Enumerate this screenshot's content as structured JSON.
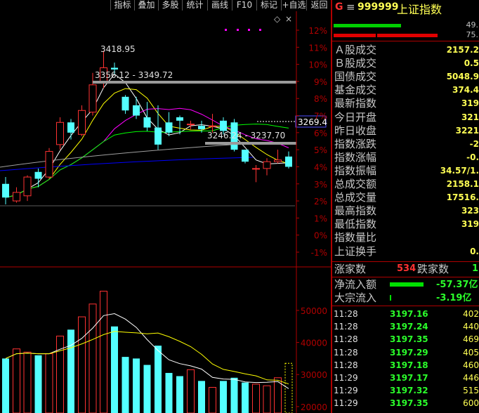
{
  "toolbar": {
    "buttons": [
      "指标",
      "叠加",
      "多股",
      "统计",
      "画线",
      "F10",
      "标记",
      "+自选",
      "返回"
    ]
  },
  "header": {
    "g_label": "G",
    "menu_glyph": "≡",
    "code": "999999",
    "name": "上证指数",
    "bar_value_1": "49.",
    "bar_value_2": "75."
  },
  "chart": {
    "price_annotations": {
      "high": "3418.95",
      "range1": "3356.12 - 3349.72",
      "range2": "3246.24 - 3237.70",
      "current": "3269.4"
    },
    "pct_axis": [
      "12%",
      "11%",
      "10%",
      "9%",
      "8%",
      "7%",
      "6%",
      "5%",
      "4%",
      "3%",
      "2%",
      "1%",
      "0%",
      "-1%"
    ],
    "vol_axis": [
      "50000",
      "40000",
      "30000",
      "20000"
    ]
  },
  "chart_data": {
    "type": "candlestick",
    "candles": [
      {
        "o": 3.0,
        "c": 2.2,
        "h": 3.4,
        "l": 1.8
      },
      {
        "o": 2.0,
        "c": 2.5,
        "h": 2.8,
        "l": 1.9
      },
      {
        "o": 2.3,
        "c": 3.4,
        "h": 3.5,
        "l": 2.0
      },
      {
        "o": 3.7,
        "c": 3.3,
        "h": 3.9,
        "l": 2.8
      },
      {
        "o": 3.4,
        "c": 4.9,
        "h": 5.1,
        "l": 3.3
      },
      {
        "o": 5.3,
        "c": 6.6,
        "h": 6.9,
        "l": 5.0
      },
      {
        "o": 6.6,
        "c": 6.0,
        "h": 6.8,
        "l": 5.6
      },
      {
        "o": 5.9,
        "c": 7.3,
        "h": 7.6,
        "l": 5.8
      },
      {
        "o": 7.2,
        "c": 8.8,
        "h": 9.5,
        "l": 7.0
      },
      {
        "o": 9.0,
        "c": 9.8,
        "h": 10.8,
        "l": 8.6
      },
      {
        "o": 9.8,
        "c": 9.7,
        "h": 10.1,
        "l": 9.4
      },
      {
        "o": 8.1,
        "c": 7.3,
        "h": 8.2,
        "l": 7.1
      },
      {
        "o": 7.6,
        "c": 7.0,
        "h": 8.1,
        "l": 6.8
      },
      {
        "o": 6.9,
        "c": 6.3,
        "h": 7.8,
        "l": 6.1
      },
      {
        "o": 6.3,
        "c": 5.3,
        "h": 7.6,
        "l": 5.0
      },
      {
        "o": 6.6,
        "c": 6.0,
        "h": 7.2,
        "l": 5.8
      },
      {
        "o": 6.9,
        "c": 6.7,
        "h": 7.0,
        "l": 5.9
      },
      {
        "o": 6.5,
        "c": 6.5,
        "h": 6.7,
        "l": 6.2
      },
      {
        "o": 6.4,
        "c": 6.2,
        "h": 6.7,
        "l": 6.0
      },
      {
        "o": 6.4,
        "c": 6.4,
        "h": 7.1,
        "l": 6.0
      },
      {
        "o": 6.7,
        "c": 6.1,
        "h": 6.9,
        "l": 5.9
      },
      {
        "o": 6.6,
        "c": 5.0,
        "h": 6.8,
        "l": 4.9
      },
      {
        "o": 5.0,
        "c": 4.3,
        "h": 5.0,
        "l": 4.2
      },
      {
        "o": 3.9,
        "c": 3.9,
        "h": 4.1,
        "l": 3.1
      },
      {
        "o": 3.9,
        "c": 4.3,
        "h": 4.5,
        "l": 3.5
      },
      {
        "o": 4.3,
        "c": 4.4,
        "h": 5.0,
        "l": 4.2
      },
      {
        "o": 4.6,
        "c": 4.0,
        "h": 4.9,
        "l": 3.9
      }
    ],
    "volumes": [
      35000,
      38000,
      37000,
      36000,
      36500,
      42000,
      44000,
      48000,
      52000,
      56000,
      45000,
      35500,
      35000,
      33000,
      39000,
      30500,
      29500,
      31500,
      28000,
      26000,
      28000,
      29000,
      27500,
      27000,
      26500,
      29000,
      18000
    ],
    "pct_range": [
      -1,
      12
    ],
    "volume_range": [
      18000,
      57000
    ]
  },
  "quote": {
    "rows": [
      {
        "label": "Ａ股成交",
        "value": "2157.2"
      },
      {
        "label": "Ｂ股成交",
        "value": "0.5"
      },
      {
        "label": "国债成交",
        "value": "5048.9"
      },
      {
        "label": "基金成交",
        "value": "374.4"
      },
      {
        "label": "最新指数",
        "value": "319"
      },
      {
        "label": "今日开盘",
        "value": "321"
      },
      {
        "label": "昨日收盘",
        "value": "3221"
      },
      {
        "label": "指数涨跌",
        "value": "-2"
      },
      {
        "label": "指数涨幅",
        "value": "-0."
      },
      {
        "label": "指数振幅",
        "value": "34.57/1."
      },
      {
        "label": "总成交额",
        "value": "2158.1"
      },
      {
        "label": "总成交量",
        "value": "17516."
      },
      {
        "label": "最高指数",
        "value": "323"
      },
      {
        "label": "最低指数",
        "value": "319"
      },
      {
        "label": "指数量比",
        "value": ""
      },
      {
        "label": "上证换手",
        "value": "0."
      }
    ],
    "rise_label": "涨家数",
    "rise_count": "534",
    "fall_label": "跌家数",
    "fall_count": "1",
    "flow": [
      {
        "label": "净流入额",
        "value": "-57.37亿"
      },
      {
        "label": "大宗流入",
        "value": "-3.19亿"
      }
    ],
    "ticks": [
      {
        "time": "11:28",
        "price": "3197.16",
        "vol": "402"
      },
      {
        "time": "11:28",
        "price": "3197.24",
        "vol": "440"
      },
      {
        "time": "11:28",
        "price": "3197.35",
        "vol": "469"
      },
      {
        "time": "11:28",
        "price": "3197.29",
        "vol": "405"
      },
      {
        "time": "11:28",
        "price": "3197.18",
        "vol": "460"
      },
      {
        "time": "11:29",
        "price": "3197.17",
        "vol": "446"
      },
      {
        "time": "11:29",
        "price": "3197.32",
        "vol": "515"
      },
      {
        "time": "11:29",
        "price": "3197.35",
        "vol": "600"
      }
    ]
  },
  "colors": {
    "up": "#ff3232",
    "down": "#54ffff",
    "axis": "#b00000",
    "ma1": "#ffffff",
    "ma2": "#ffff00",
    "ma3": "#ff00ff",
    "ma4": "#00ff00",
    "ma5": "#a0a0a0",
    "ma6": "#0000ff"
  }
}
